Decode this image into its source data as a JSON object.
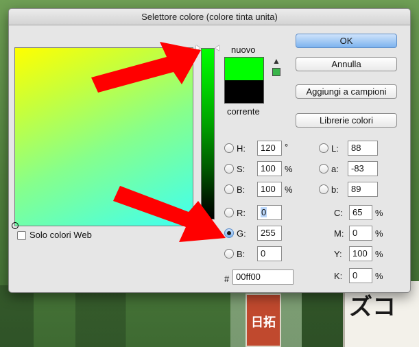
{
  "background": {
    "sign_text": "日拓",
    "board_text": "ズコ"
  },
  "dialog": {
    "title": "Selettore colore (colore tinta unita)",
    "labels": {
      "nuovo": "nuovo",
      "corrente": "corrente",
      "solo_colori_web": "Solo colori Web",
      "hash": "#"
    },
    "colors": {
      "new": "#00ff00",
      "current": "#000000",
      "accent": "#ff0000"
    },
    "buttons": {
      "ok": "OK",
      "annulla": "Annulla",
      "aggiungi": "Aggiungi a campioni",
      "librerie": "Librerie colori"
    },
    "hsb": [
      {
        "key": "H:",
        "value": "120",
        "unit": "°",
        "selected": false
      },
      {
        "key": "S:",
        "value": "100",
        "unit": "%",
        "selected": false
      },
      {
        "key": "B:",
        "value": "100",
        "unit": "%",
        "selected": false
      }
    ],
    "rgb": [
      {
        "key": "R:",
        "value": "0",
        "selected": false
      },
      {
        "key": "G:",
        "value": "255",
        "selected": true
      },
      {
        "key": "B:",
        "value": "0",
        "selected": false
      }
    ],
    "lab": [
      {
        "key": "L:",
        "value": "88"
      },
      {
        "key": "a:",
        "value": "-83"
      },
      {
        "key": "b:",
        "value": "89"
      }
    ],
    "cmyk": [
      {
        "key": "C:",
        "value": "65",
        "unit": "%"
      },
      {
        "key": "M:",
        "value": "0",
        "unit": "%"
      },
      {
        "key": "Y:",
        "value": "100",
        "unit": "%"
      },
      {
        "key": "K:",
        "value": "0",
        "unit": "%"
      }
    ],
    "hex": "00ff00",
    "icons": {
      "warning": "warning-icon",
      "gamut": "web-safe-swatch-icon"
    }
  }
}
